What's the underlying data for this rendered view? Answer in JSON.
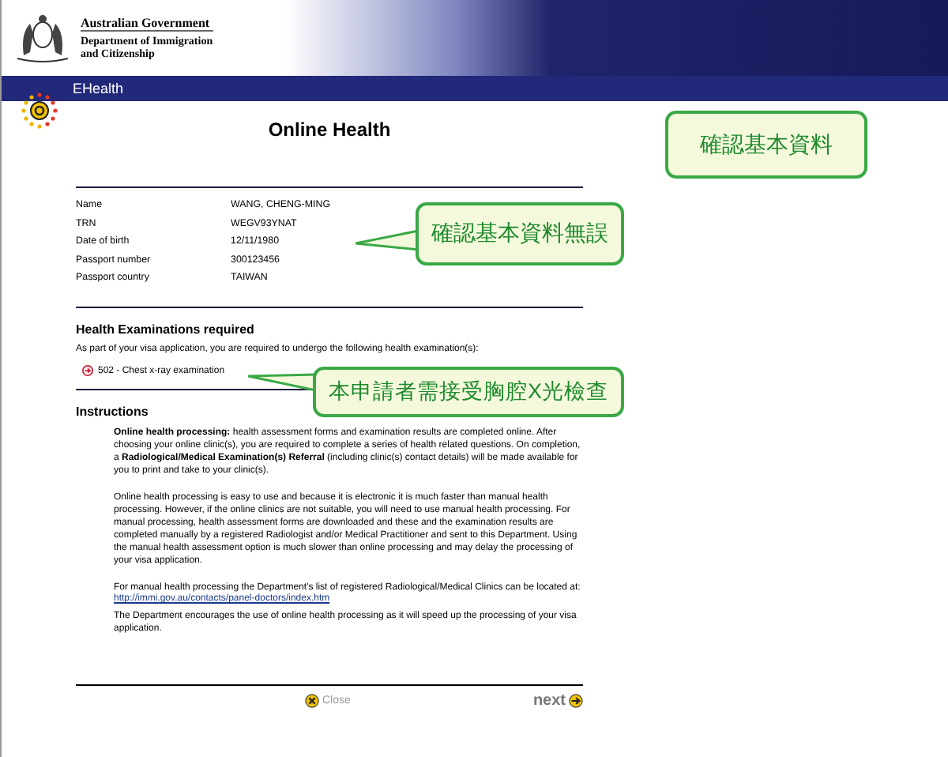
{
  "header": {
    "agency": "Australian Government",
    "department_lines": [
      "Department of Immigration",
      "and Citizenship"
    ]
  },
  "nav_bar": {
    "title": "EHealth"
  },
  "page_title": "Online Health",
  "applicant": [
    {
      "label": "Name",
      "value": "WANG, CHENG-MING"
    },
    {
      "label": "TRN",
      "value": "WEGV93YNAT"
    },
    {
      "label": "Date of birth",
      "value": "12/11/1980"
    },
    {
      "label": "Passport number",
      "value": "300123456"
    },
    {
      "label": "Passport country",
      "value": "TAIWAN"
    }
  ],
  "health_exams": {
    "heading": "Health Examinations required",
    "intro": "As part of your visa application, you are required to undergo the following health examination(s):",
    "items": [
      "502 - Chest x-ray examination"
    ]
  },
  "instructions": {
    "heading": "Instructions",
    "blocks": [
      {
        "kind": "text",
        "text": "**Online health processing:** health assessment forms and examination results are completed online. After choosing your online clinic(s), you are required to complete a series of health related questions. On completion, a **Radiological/Medical Examination(s) Referral** (including clinic(s) contact details) will be made available for you to print and take to your clinic(s)."
      },
      {
        "kind": "text",
        "text": "Online health processing is easy to use and because it is electronic it is much faster than manual health processing. However, if the online clinics are not suitable, you will need to use manual health processing. For manual processing, health assessment forms are downloaded and these and the examination results are completed manually by a registered Radiologist and/or Medical Practitioner and sent to this Department. Using the manual health assessment option is much slower than online processing and may delay the processing of your visa application."
      },
      {
        "kind": "text",
        "text": "For manual health processing the Department's list of registered Radiological/Medical Clinics can be located at:"
      },
      {
        "kind": "link",
        "text": "http://immi.gov.au/contacts/panel-doctors/index.htm"
      },
      {
        "kind": "text",
        "text": "The Department encourages the use of online health processing as it will speed up the processing of your visa application."
      }
    ]
  },
  "footer": {
    "close": "Close",
    "next": "next"
  },
  "callouts": [
    {
      "kind": "plain",
      "text": "確認基本資料"
    },
    {
      "kind": "pointer",
      "text": "確認基本資料無誤"
    },
    {
      "kind": "pointer",
      "text": "本申請者需接受胸腔X光檢查"
    }
  ]
}
